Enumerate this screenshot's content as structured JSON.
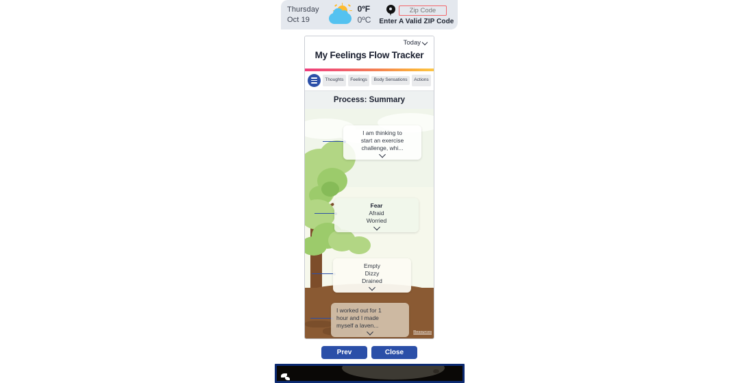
{
  "weather": {
    "day": "Thursday",
    "date": "Oct 19",
    "temp_f": "0ºF",
    "temp_c": "0ºC",
    "zip_placeholder": "Zip Code",
    "zip_value": "",
    "zip_error": "Enter A Valid ZIP Code",
    "icon_sun": "sun-icon",
    "icon_cloud": "cloud-icon",
    "icon_pin": "location-pin-icon",
    "error_color": "#f1676b"
  },
  "card": {
    "today_label": "Today",
    "title": "My Feelings Flow Tracker",
    "menu_icon": "hamburger-menu-icon",
    "tabs": [
      {
        "label": "Thoughts"
      },
      {
        "label": "Feelings"
      },
      {
        "label": "Body Sensations"
      },
      {
        "label": "Actions"
      }
    ],
    "section_header": "Process: Summary",
    "accent_gradient_start": "#ef3e7c",
    "accent_gradient_end": "#fdc545",
    "accent_blue": "#2b4fa8"
  },
  "nodes": {
    "thought": {
      "lines": [
        "I am thinking to",
        "start an exercise",
        "challenge, whi..."
      ],
      "expand_icon": "chevron-down-icon"
    },
    "feeling": {
      "title": "Fear",
      "lines": [
        "Afraid",
        "Worried"
      ],
      "expand_icon": "chevron-down-icon"
    },
    "body": {
      "lines": [
        "Empty",
        "Dizzy",
        "Drained"
      ],
      "expand_icon": "chevron-down-icon"
    },
    "action": {
      "lines": [
        "I worked out for 1",
        "hour and I made",
        "myself a laven..."
      ],
      "expand_icon": "chevron-down-icon"
    }
  },
  "resources_link": "Resources",
  "footer": {
    "prev_label": "Prev",
    "close_label": "Close"
  },
  "banner": {
    "text": "",
    "bg_color": "#0c2a72"
  }
}
